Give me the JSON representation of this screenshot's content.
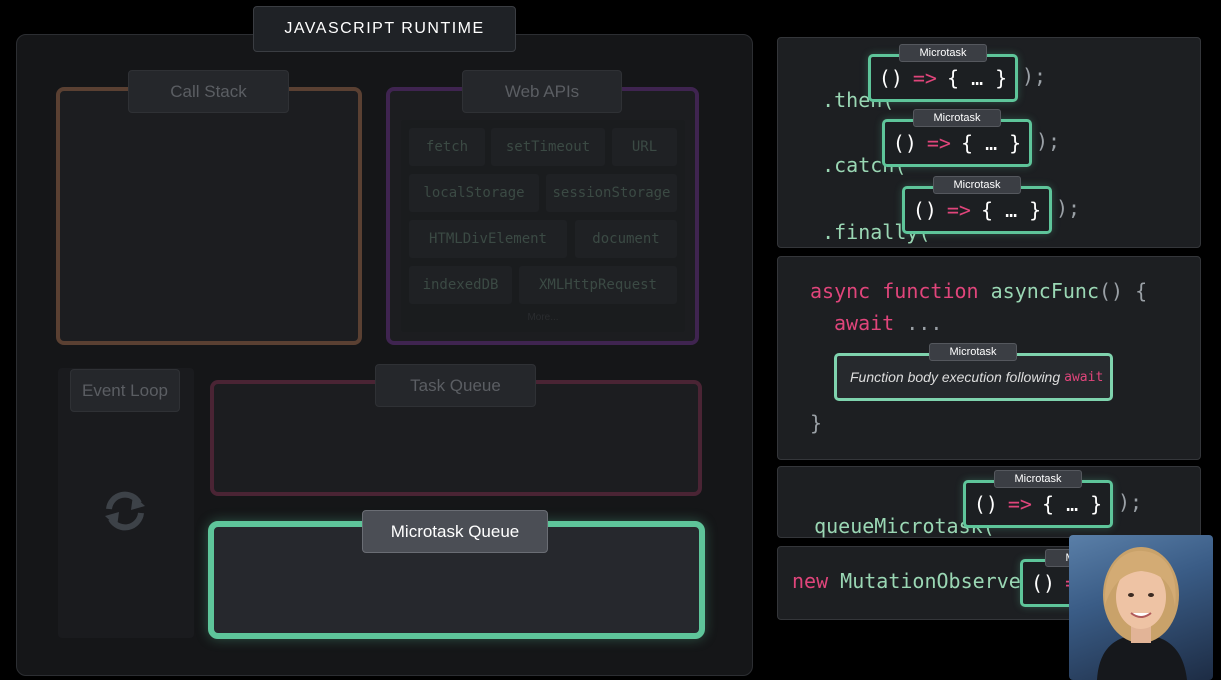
{
  "runtime": {
    "title": "JAVASCRIPT RUNTIME"
  },
  "call_stack": {
    "title": "Call Stack"
  },
  "web_apis": {
    "title": "Web APIs",
    "items": [
      "fetch",
      "setTimeout",
      "URL",
      "localStorage",
      "sessionStorage",
      "HTMLDivElement",
      "document",
      "indexedDB",
      "XMLHttpRequest"
    ],
    "more": "More..."
  },
  "event_loop": {
    "title": "Event Loop"
  },
  "task_queue": {
    "title": "Task Queue"
  },
  "microtask_queue": {
    "title": "Microtask Queue"
  },
  "code": {
    "microtask_label": "Microtask",
    "callback": {
      "open": "()",
      "arrow": "=>",
      "body": "{ … }"
    },
    "then": {
      "method": ".then(",
      "close": ");"
    },
    "catch": {
      "method": ".catch(",
      "close": ");"
    },
    "finally": {
      "method": ".finally(",
      "close": ");"
    },
    "async_fn": {
      "kw_async": "async",
      "kw_function": "function",
      "name": "asyncFunc",
      "params": "() {",
      "kw_await": "await",
      "ellipsis": "...",
      "body_text": "Function body execution following",
      "body_kw": "await",
      "close": "}"
    },
    "queue_microtask": {
      "method": "queueMicrotask(",
      "close": ");"
    },
    "mutation_observer": {
      "kw_new": "new",
      "name": "MutationObserver("
    }
  },
  "colors": {
    "microtask_green": "#5ec59a",
    "keyword_pink": "#e0457b",
    "method_green": "#9ad7b4"
  },
  "icons": [
    "refresh-loop-icon"
  ]
}
